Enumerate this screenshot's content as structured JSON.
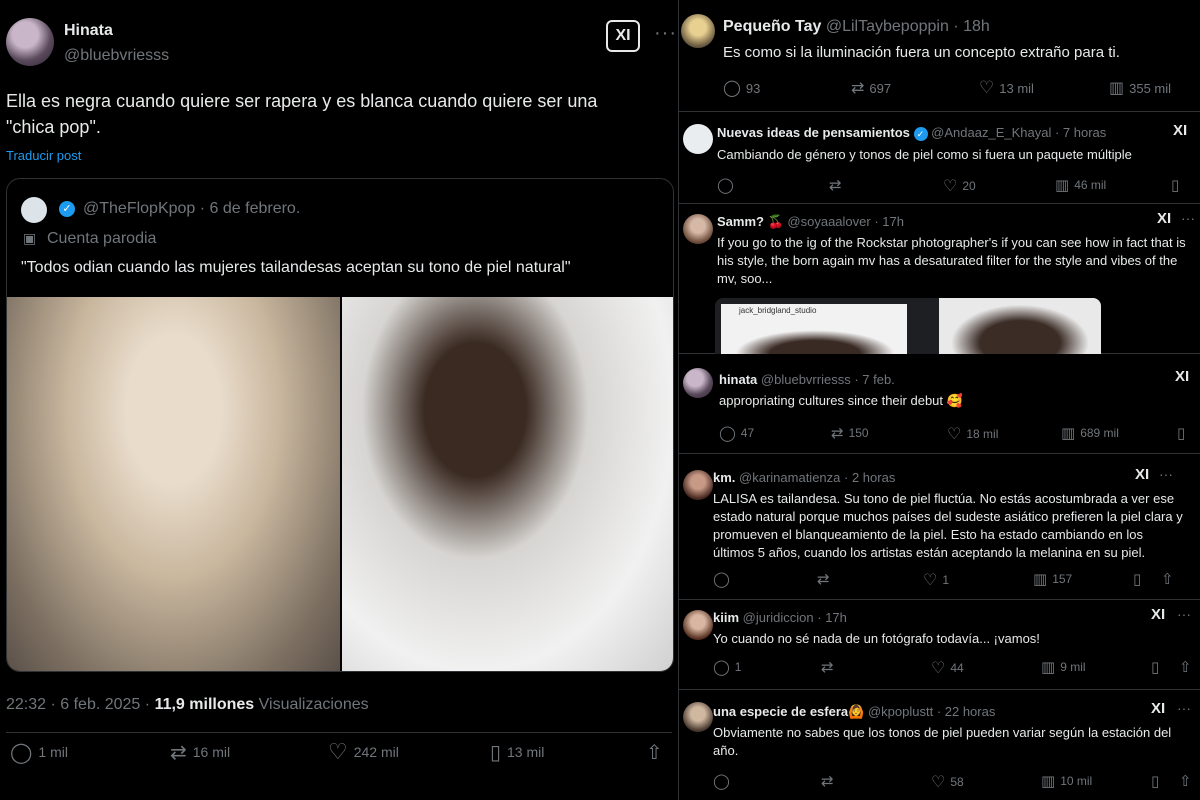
{
  "main_tweet": {
    "author_name": "Hinata",
    "author_handle": "@bluebvriesss",
    "text_line1": "Ella es negra cuando quiere ser rapera y es blanca cuando quiere ser una",
    "text_line2": "\"chica pop\".",
    "translate": "Traducir post",
    "timestamp": "22:32 · 6 feb. 2025 ·",
    "views_count": "11,9 millones",
    "views_label": "Visualizaciones",
    "replies": "1 mil",
    "reposts": "16 mil",
    "likes": "242 mil",
    "bookmarks": "13 mil",
    "quoted": {
      "handle": "@TheFlopKpop",
      "date": "· 6 de febrero.",
      "parody_label": "Cuenta parodia",
      "text": "\"Todos odian cuando las mujeres tailandesas aceptan su tono de piel natural\""
    }
  },
  "replies": [
    {
      "name": "Pequeño Tay",
      "handle": "@LilTaybepoppin",
      "time": "· 18h",
      "text": "Es como si la iluminación fuera un concepto extraño para ti.",
      "replies": "93",
      "reposts": "697",
      "likes": "13 mil",
      "views": "355 mil"
    },
    {
      "name": "Nuevas ideas de pensamientos",
      "handle": "@Andaaz_E_Khayal",
      "time": "· 7 horas",
      "text": "Cambiando de género y tonos de piel como si fuera un paquete múltiple",
      "replies": "",
      "reposts": "",
      "likes": "20",
      "views": "46 mil"
    },
    {
      "name": "Samm?",
      "emoji": "🍒",
      "handle": "@soyaaalover",
      "time": "· 17h",
      "text": "If you go to the ig of the Rockstar photographer's if you can see how in fact that is his style, the born again mv has a desaturated filter for the style and vibes of the mv, soo...",
      "embed_label": "jack_bridgland_studio"
    },
    {
      "name": "hinata",
      "handle": "@bluebvrriesss",
      "time": "· 7 feb.",
      "text": "appropriating cultures since their debut 🥰",
      "replies": "47",
      "reposts": "150",
      "likes": "18 mil",
      "views": "689 mil"
    },
    {
      "name": "km.",
      "handle": "@karinamatienza",
      "time": "· 2 horas",
      "text": "LALISA es tailandesa. Su tono de piel fluctúa. No estás acostumbrada a ver ese estado natural porque muchos países del sudeste asiático prefieren la piel clara y promueven el blanqueamiento de la piel. Esto ha estado cambiando en los últimos 5 años, cuando los artistas están aceptando la melanina en su piel.",
      "replies": "",
      "reposts": "",
      "likes": "1",
      "views": "157"
    },
    {
      "name": "kiim",
      "handle": "@juridiccion",
      "time": "· 17h",
      "text": "Yo cuando no sé nada de un fotógrafo todavía... ¡vamos!",
      "replies": "1",
      "reposts": "",
      "likes": "44",
      "views": "9 mil"
    },
    {
      "name": "una especie de esfera",
      "emoji": "🙆",
      "handle": "@kpoplustt",
      "time": "· 22 horas",
      "text": "Obviamente no sabes que los tonos de piel pueden variar según la estación del año.",
      "replies": "",
      "reposts": "",
      "likes": "58",
      "views": "10 mil"
    }
  ],
  "icons": {
    "grok": "XI",
    "more": "···",
    "reply": "◯",
    "repost": "⇄",
    "like": "♡",
    "views": "▥",
    "bookmark": "▯",
    "share": "⇧"
  }
}
